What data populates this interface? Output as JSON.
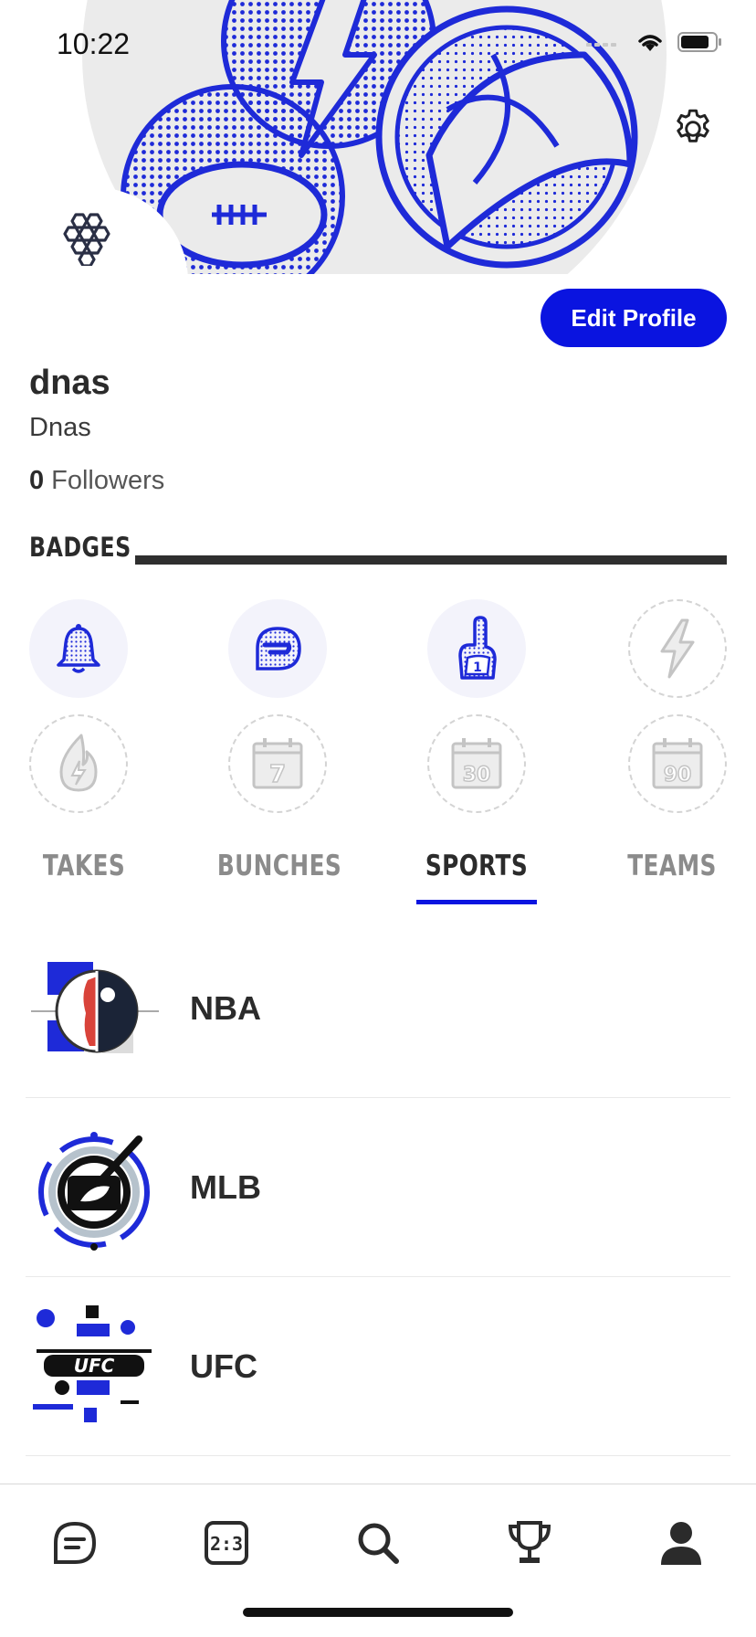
{
  "status_bar": {
    "time": "10:22"
  },
  "profile": {
    "edit_button_label": "Edit Profile",
    "username": "dnas",
    "display_name": "Dnas",
    "followers_count": "0",
    "followers_label": "Followers"
  },
  "badges": {
    "title": "BADGES",
    "items": [
      {
        "icon": "bell-icon",
        "earned": true
      },
      {
        "icon": "chat-bubble-icon",
        "earned": true
      },
      {
        "icon": "foam-finger-icon",
        "earned": true
      },
      {
        "icon": "lightning-icon",
        "earned": false
      },
      {
        "icon": "flame-icon",
        "earned": false
      },
      {
        "icon": "calendar-7-icon",
        "earned": false,
        "text": "7"
      },
      {
        "icon": "calendar-30-icon",
        "earned": false,
        "text": "30"
      },
      {
        "icon": "calendar-90-icon",
        "earned": false,
        "text": "90"
      }
    ]
  },
  "tabs": [
    {
      "label": "TAKES",
      "active": false
    },
    {
      "label": "BUNCHES",
      "active": false
    },
    {
      "label": "SPORTS",
      "active": true
    },
    {
      "label": "TEAMS",
      "active": false
    }
  ],
  "sports": [
    {
      "name": "NBA",
      "logo": "nba-logo"
    },
    {
      "name": "MLB",
      "logo": "mlb-logo"
    },
    {
      "name": "UFC",
      "logo": "ufc-logo"
    }
  ],
  "bottom_nav": [
    {
      "name": "chat-icon",
      "active": false
    },
    {
      "name": "scoreboard-icon",
      "active": false
    },
    {
      "name": "search-icon",
      "active": false
    },
    {
      "name": "trophy-icon",
      "active": false
    },
    {
      "name": "profile-icon",
      "active": true
    }
  ],
  "colors": {
    "accent": "#0a14e0",
    "text": "#2b2b2b",
    "muted": "#8b8b8b"
  }
}
